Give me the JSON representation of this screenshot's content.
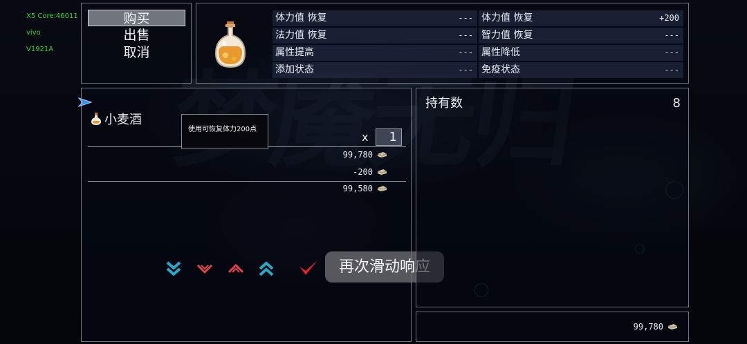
{
  "device": {
    "core": "X5 Core:46011",
    "brand": "vivo",
    "model": "V1921A"
  },
  "commands": {
    "buy": "购买",
    "sell": "出售",
    "cancel": "取消"
  },
  "stats": [
    {
      "label": "体力值 恢复",
      "value": "---"
    },
    {
      "label": "法力值 恢复",
      "value": "---"
    },
    {
      "label": "属性提高",
      "value": "---"
    },
    {
      "label": "添加状态",
      "value": "---"
    },
    {
      "label": "体力值 恢复",
      "value": "+200"
    },
    {
      "label": "智力值 恢复",
      "value": "---"
    },
    {
      "label": "属性降低",
      "value": "---"
    },
    {
      "label": "免疫状态",
      "value": "---"
    }
  ],
  "item": {
    "name": "小麦酒",
    "description": "使用可恢复体力200点",
    "qty_prefix": "x",
    "quantity": "1"
  },
  "money": {
    "current": "99,780",
    "cost": "-200",
    "after": "99,580"
  },
  "owned": {
    "label": "持有数",
    "count": "8"
  },
  "gold": "99,780",
  "hint": "再次滑动响应",
  "colors": {
    "arrow_cyan": "#2aa8c8",
    "arrow_red": "#e0424a",
    "confirm_red": "#e01e2e"
  },
  "icons": [
    "cursor-arrow-icon",
    "potion-icon",
    "coin-icon",
    "double-down-icon",
    "down-icon",
    "up-icon",
    "double-up-icon",
    "check-icon"
  ]
}
